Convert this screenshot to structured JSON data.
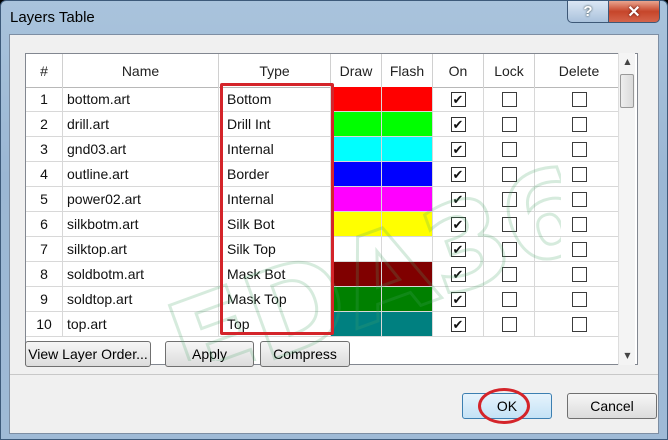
{
  "window": {
    "title": "Layers Table",
    "help_label": "?",
    "close_label": "✕"
  },
  "columns": [
    "#",
    "Name",
    "Type",
    "Draw",
    "Flash",
    "On",
    "Lock",
    "Delete"
  ],
  "rows": [
    {
      "num": "1",
      "name": "bottom.art",
      "type": "Bottom",
      "color": "#ff0000",
      "on": true
    },
    {
      "num": "2",
      "name": "drill.art",
      "type": "Drill Int",
      "color": "#00ff00",
      "on": true
    },
    {
      "num": "3",
      "name": "gnd03.art",
      "type": "Internal",
      "color": "#00ffff",
      "on": true
    },
    {
      "num": "4",
      "name": "outline.art",
      "type": "Border",
      "color": "#0000ff",
      "on": true
    },
    {
      "num": "5",
      "name": "power02.art",
      "type": "Internal",
      "color": "#ff00ff",
      "on": true
    },
    {
      "num": "6",
      "name": "silkbotm.art",
      "type": "Silk Bot",
      "color": "#ffff00",
      "on": true
    },
    {
      "num": "7",
      "name": "silktop.art",
      "type": "Silk Top",
      "color": "#ffffff",
      "on": true
    },
    {
      "num": "8",
      "name": "soldbotm.art",
      "type": "Mask Bot",
      "color": "#800000",
      "on": true
    },
    {
      "num": "9",
      "name": "soldtop.art",
      "type": "Mask Top",
      "color": "#008000",
      "on": true
    },
    {
      "num": "10",
      "name": "top.art",
      "type": "Top",
      "color": "#008080",
      "on": true
    }
  ],
  "buttons": {
    "view_layer_order": "View Layer Order...",
    "apply": "Apply",
    "compress": "Compress",
    "ok": "OK",
    "cancel": "Cancel"
  },
  "watermark": "EDA365",
  "checkmark_glyph": "✔",
  "colors": {
    "highlight": "#d4242a",
    "ok_accent": "#3c7fb1"
  },
  "icons": {
    "scroll_up": "▲",
    "scroll_down": "▼"
  }
}
